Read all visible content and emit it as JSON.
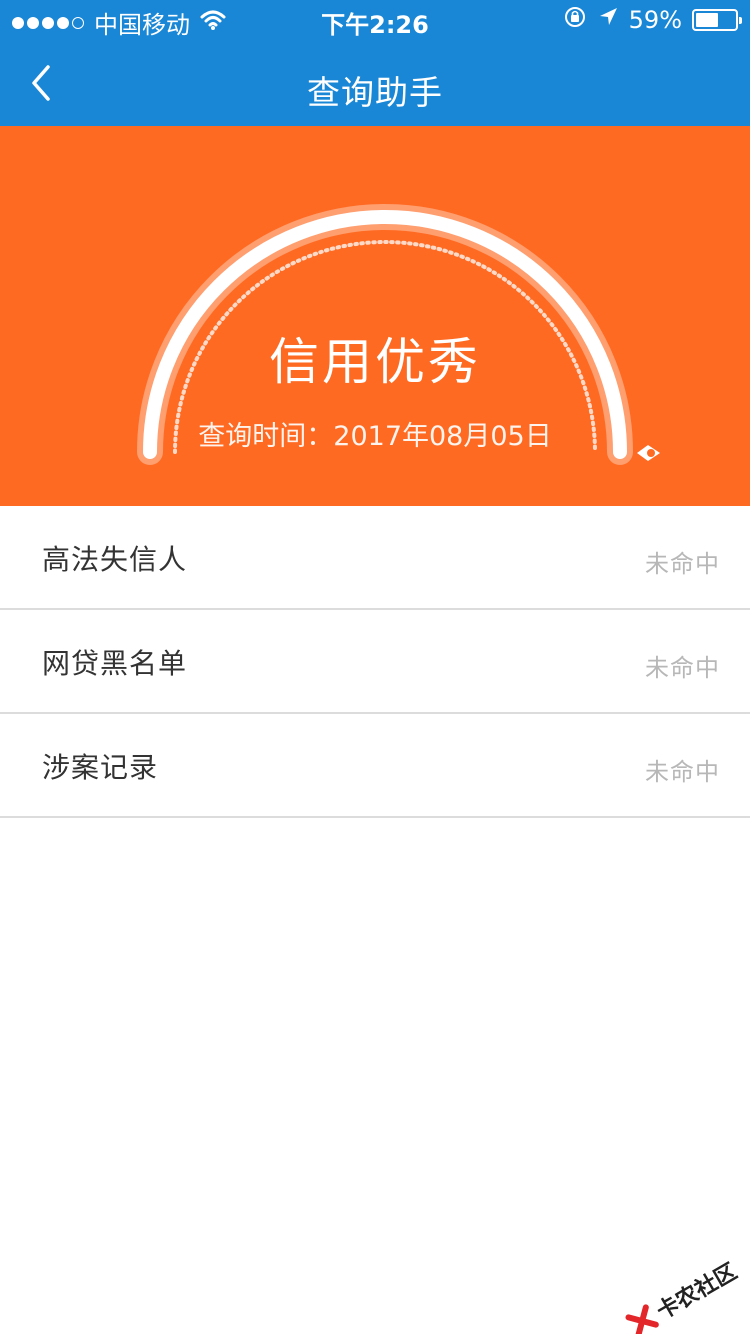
{
  "status_bar": {
    "carrier": "中国移动",
    "time": "下午2:26",
    "battery_percent": "59%",
    "battery_level": 0.59,
    "signal_bars": 4
  },
  "nav": {
    "title": "查询助手",
    "back_icon": "chevron-left-icon"
  },
  "hero": {
    "status": "信用优秀",
    "query_time": "查询时间：2017年08月05日",
    "background": "#ff6a22"
  },
  "list": [
    {
      "label": "高法失信人",
      "status": "未命中"
    },
    {
      "label": "网贷黑名单",
      "status": "未命中"
    },
    {
      "label": "涉案记录",
      "status": "未命中"
    }
  ],
  "watermark": {
    "text": "卡农社区"
  },
  "colors": {
    "nav_blue": "#1a87d6",
    "hero_orange": "#ff6a22"
  }
}
